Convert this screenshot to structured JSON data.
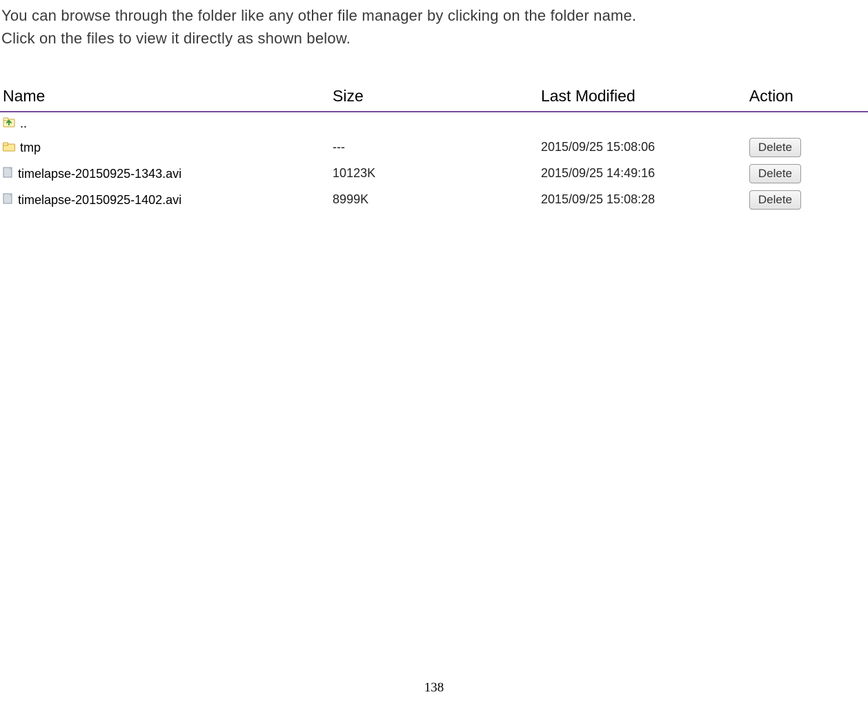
{
  "intro": {
    "line1": "You can browse through the folder like any other file manager by clicking on the folder name.",
    "line2": "Click on the files to view it directly as shown below."
  },
  "table": {
    "headers": {
      "name": "Name",
      "size": "Size",
      "modified": "Last Modified",
      "action": "Action"
    },
    "up": {
      "name": ".."
    },
    "rows": [
      {
        "type": "folder",
        "name": "tmp",
        "size": "---",
        "modified": "2015/09/25 15:08:06",
        "action": "Delete"
      },
      {
        "type": "file",
        "name": "timelapse-20150925-1343.avi",
        "size": "10123K",
        "modified": "2015/09/25 14:49:16",
        "action": "Delete"
      },
      {
        "type": "file",
        "name": "timelapse-20150925-1402.avi",
        "size": "8999K",
        "modified": "2015/09/25 15:08:28",
        "action": "Delete"
      }
    ]
  },
  "page_number": "138"
}
